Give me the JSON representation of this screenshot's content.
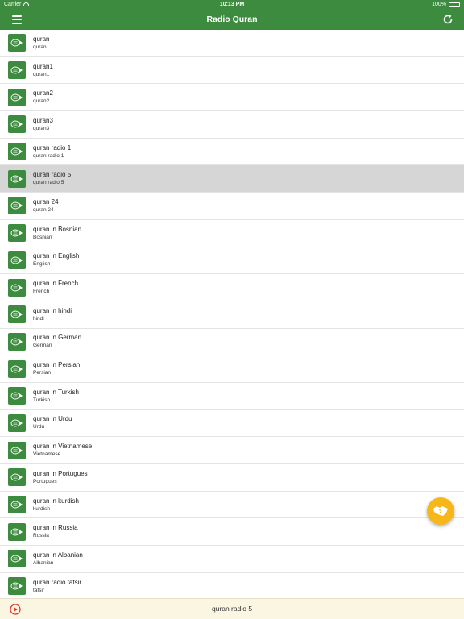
{
  "status_bar": {
    "carrier": "Carrier",
    "time": "10:13 PM",
    "battery": "100%"
  },
  "header": {
    "title": "Radio Quran"
  },
  "stations": [
    {
      "title": "quran",
      "subtitle": "quran"
    },
    {
      "title": "quran1",
      "subtitle": "quran1"
    },
    {
      "title": "quran2",
      "subtitle": "quran2"
    },
    {
      "title": "quran3",
      "subtitle": "quran3"
    },
    {
      "title": "quran radio 1",
      "subtitle": "quran radio 1"
    },
    {
      "title": "quran radio 5",
      "subtitle": "quran radio 5"
    },
    {
      "title": "quran 24",
      "subtitle": "quran 24"
    },
    {
      "title": "quran in Bosnian",
      "subtitle": "Bosnian"
    },
    {
      "title": "quran in English",
      "subtitle": "English"
    },
    {
      "title": "quran in French",
      "subtitle": "French"
    },
    {
      "title": "quran in hindi",
      "subtitle": "hindi"
    },
    {
      "title": "quran in German",
      "subtitle": "German"
    },
    {
      "title": "quran in Persian",
      "subtitle": "Persian"
    },
    {
      "title": "quran in Turkish",
      "subtitle": "Turkish"
    },
    {
      "title": "quran in Urdu",
      "subtitle": "Urdu"
    },
    {
      "title": "quran in Vietnamese",
      "subtitle": "Vietnamese"
    },
    {
      "title": "quran in Portugues",
      "subtitle": "Portugues"
    },
    {
      "title": "quran in kurdish",
      "subtitle": "kurdish"
    },
    {
      "title": "quran in Russia",
      "subtitle": "Russia"
    },
    {
      "title": "quran in Albanian",
      "subtitle": "Albanian"
    },
    {
      "title": "quran radio tafsir",
      "subtitle": "tafsir"
    }
  ],
  "selected_station": "quran radio 5",
  "player": {
    "now_playing": "quran radio 5"
  },
  "icons": {
    "menu": "hamburger-menu-icon",
    "refresh": "refresh-icon",
    "station": "quran-play-icon",
    "fab": "handshake-icon",
    "play": "play-circle-icon"
  },
  "colors": {
    "primary": "#3c8b3f",
    "fab": "#f7b718",
    "player_bg": "#fbf6e1",
    "play_accent": "#e53935",
    "selected_row": "#d6d6d6"
  }
}
